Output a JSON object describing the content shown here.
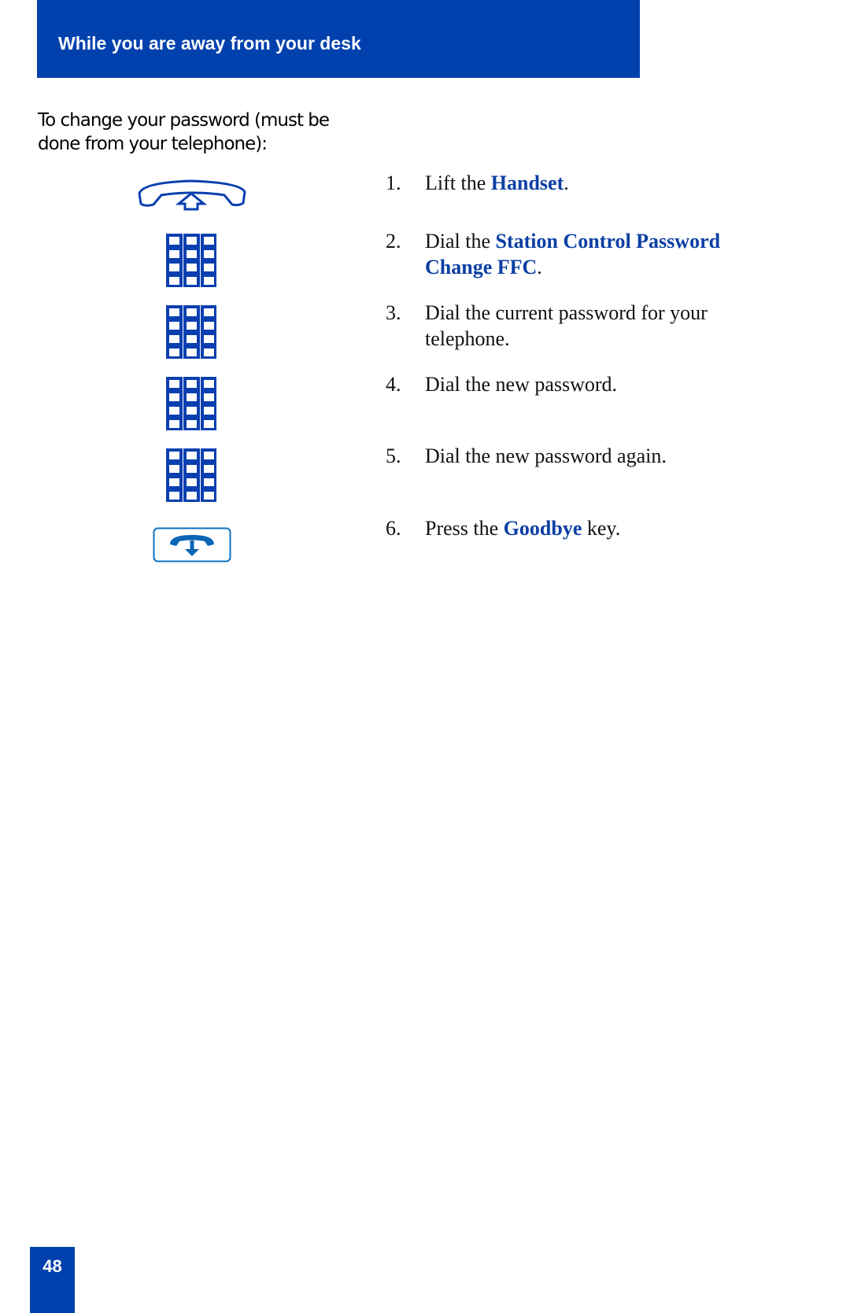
{
  "header": {
    "title": "While you are away from your desk"
  },
  "section": {
    "heading": "To change your password (must be done from your telephone):"
  },
  "steps": [
    {
      "num": "1.",
      "pre": "Lift the ",
      "key": "Handset",
      "post": ".",
      "icon": "handset-lift-icon"
    },
    {
      "num": "2.",
      "pre": "Dial the ",
      "key": "Station Control Password Change FFC",
      "post": ".",
      "icon": "dialpad-icon"
    },
    {
      "num": "3.",
      "pre": "Dial the current password for your telephone.",
      "key": "",
      "post": "",
      "icon": "dialpad-icon"
    },
    {
      "num": "4.",
      "pre": "Dial the new password.",
      "key": "",
      "post": "",
      "icon": "dialpad-icon"
    },
    {
      "num": "5.",
      "pre": "Dial the new password again.",
      "key": "",
      "post": "",
      "icon": "dialpad-icon"
    },
    {
      "num": "6.",
      "pre": "Press the ",
      "key": "Goodbye",
      "post": " key.",
      "icon": "goodbye-key-icon"
    }
  ],
  "footer": {
    "page_number": "48"
  },
  "colors": {
    "brand_blue": "#0041ad",
    "key_text_blue": "#0b3fa3",
    "icon_blue": "#0a3fb0"
  }
}
